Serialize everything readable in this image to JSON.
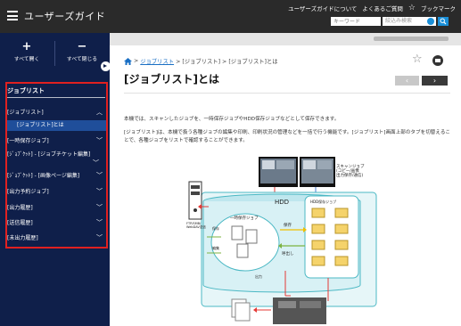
{
  "header": {
    "title": "ユーザーズガイド",
    "links": [
      "ユーザーズガイドについて",
      "よくあるご質問",
      "ブックマーク"
    ],
    "search_placeholder": "キーワード",
    "filter_label": "絞込み検索"
  },
  "sidebar": {
    "expand_all": "すべて開く",
    "collapse_all": "すべて閉じる",
    "nav_title": "ジョブリスト",
    "items": [
      "[ジョブリスト]",
      "[ジョブリスト]とは",
      "[一時保存ジョブ]",
      "[ｼﾞｮﾌﾞｹｯﾄ] - [ジョブチケット編集]",
      "[ｼﾞｮﾌﾞｹｯﾄ] - [画像ページ編集]",
      "[出力予約ジョブ]",
      "[出力履歴]",
      "[送信履歴]",
      "[未出力履歴]"
    ]
  },
  "breadcrumb": {
    "link": "ジョブリスト",
    "rest": " > [ジョブリスト] > [ジョブリスト]とは"
  },
  "page": {
    "title": "[ジョブリスト]とは",
    "prev_glyph": "‹",
    "next_glyph": "›",
    "para1": "本機では、スキャンしたジョブを、一時保存ジョブやHDD保存ジョブなどとして保存できます。",
    "para2": "[ジョブリスト]は、本機で扱う各種ジョブの編集や印刷、印刷状況の管理などを一括で行う機能です。[ジョブリスト]画面上部のタブを切替えることで、各種ジョブをリストで確認することができます。"
  },
  "diagram": {
    "hdd_label": "HDD",
    "hdd_save_job": "HDD保存ジョブ",
    "scan_job": "スキャンジョブ\n(コピー/画像\n出力保存/通信)",
    "temp_job": "一時保存ジョブ",
    "save_label": "保存",
    "recall_label": "呼出し",
    "server_label": "FTP/SMB/\nWebDAV送信",
    "output_label": "出力",
    "print_label": "印刷",
    "edit_label": "編集"
  },
  "colors": {
    "header_bg": "#2a2a2a",
    "sidebar_bg": "#0f1f4a",
    "accent_blue": "#1a8fd8",
    "nav_highlight": "#e02020",
    "diagram_teal": "#4bb8c4"
  }
}
